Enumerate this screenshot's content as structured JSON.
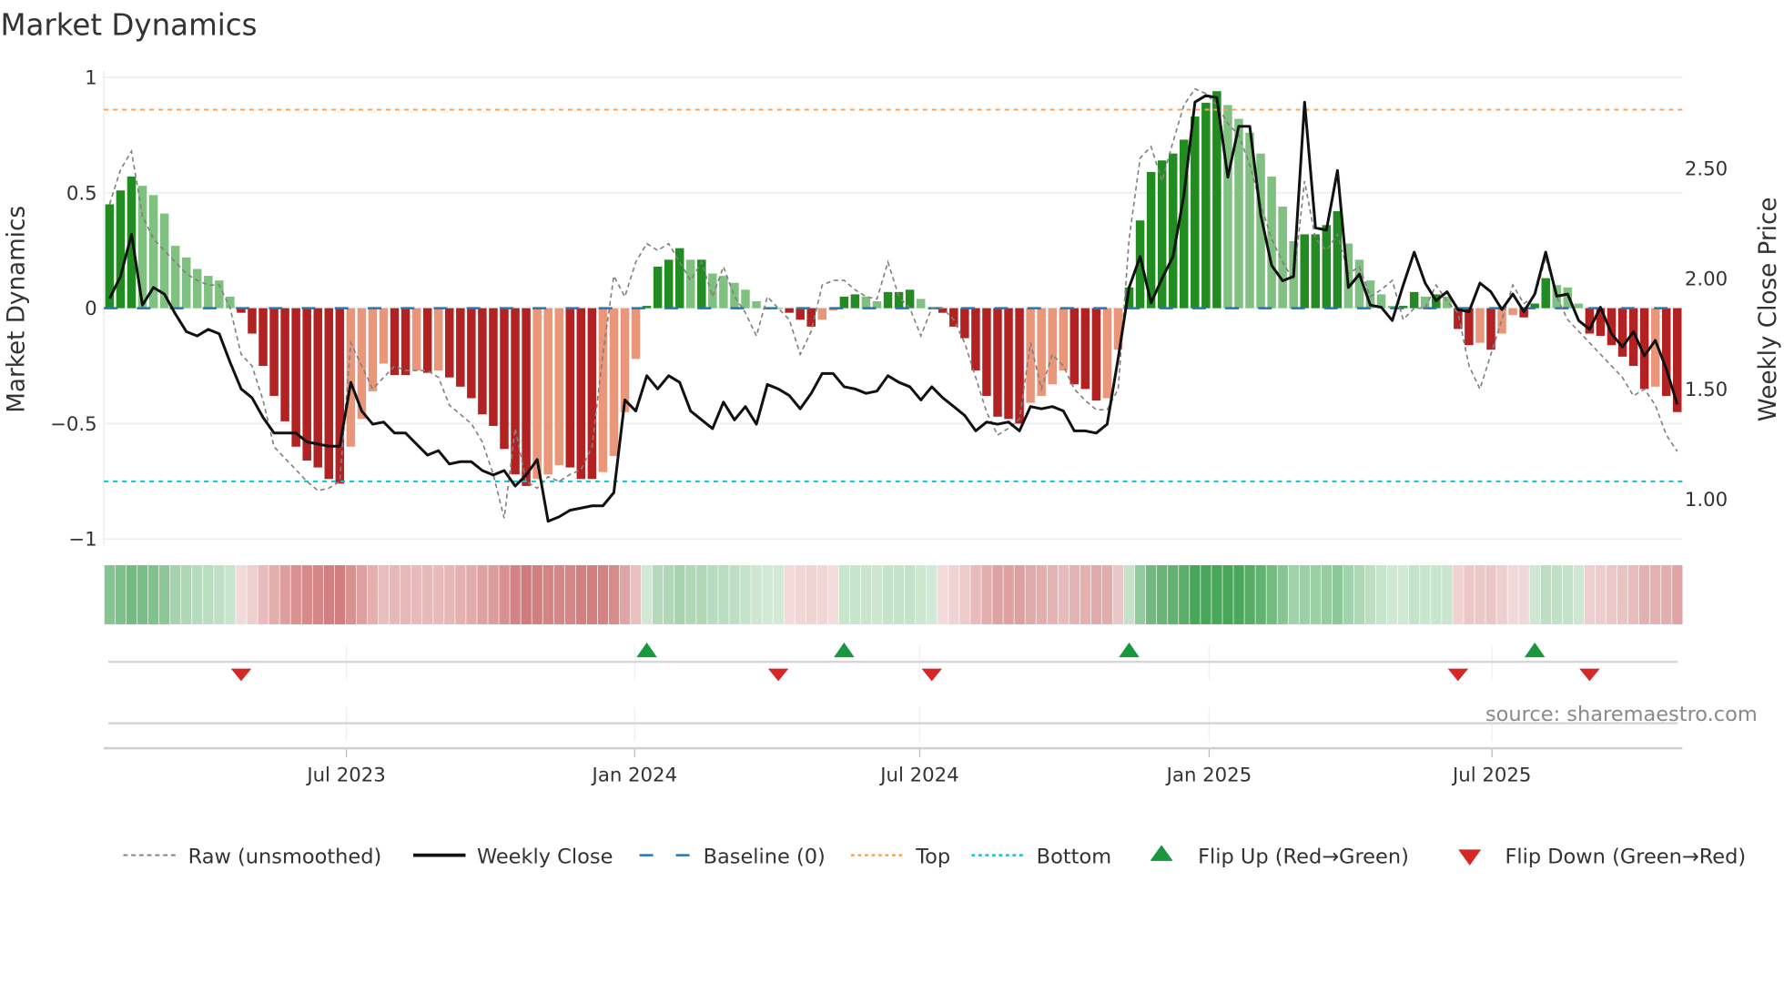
{
  "chart_data": {
    "type": "bar",
    "title": "Market Dynamics",
    "ylabel": "Market Dynamics",
    "y2label": "Weekly Close Price",
    "ylim": [
      -1,
      1
    ],
    "y2lim": [
      0.85,
      2.86
    ],
    "yticks": [
      "1",
      "0.5",
      "0",
      "−0.5",
      "−1"
    ],
    "ytick_values": [
      1,
      0.5,
      0,
      -0.5,
      -1
    ],
    "y2ticks": [
      "2.50",
      "2.00",
      "1.50",
      "1.00"
    ],
    "y2tick_values": [
      2.5,
      2.0,
      1.5,
      1.0
    ],
    "x_unit": "week index",
    "x_ticks": [
      {
        "label": "Jul 2023",
        "week": 21.6
      },
      {
        "label": "Jan 2024",
        "week": 47.9
      },
      {
        "label": "Jul 2024",
        "week": 73.9
      },
      {
        "label": "Jan 2025",
        "week": 100.3
      },
      {
        "label": "Jul 2025",
        "week": 126.1
      }
    ],
    "top_level": 0.86,
    "bottom_level": -0.75,
    "baseline": 0,
    "dynamics": [
      0.45,
      0.51,
      0.57,
      0.53,
      0.49,
      0.41,
      0.27,
      0.22,
      0.17,
      0.14,
      0.12,
      0.05,
      -0.02,
      -0.11,
      -0.25,
      -0.38,
      -0.49,
      -0.6,
      -0.66,
      -0.69,
      -0.74,
      -0.76,
      -0.6,
      -0.48,
      -0.36,
      -0.24,
      -0.29,
      -0.29,
      -0.27,
      -0.28,
      -0.27,
      -0.3,
      -0.34,
      -0.39,
      -0.46,
      -0.51,
      -0.61,
      -0.72,
      -0.77,
      -0.74,
      -0.72,
      -0.68,
      -0.69,
      -0.74,
      -0.74,
      -0.71,
      -0.64,
      -0.45,
      -0.22,
      0.01,
      0.18,
      0.21,
      0.26,
      0.21,
      0.21,
      0.15,
      0.14,
      0.11,
      0.08,
      0.03,
      0.0,
      0.0,
      -0.02,
      -0.05,
      -0.08,
      -0.05,
      -0.01,
      0.05,
      0.06,
      0.05,
      0.03,
      0.07,
      0.07,
      0.08,
      0.04,
      0.0,
      -0.02,
      -0.08,
      -0.13,
      -0.27,
      -0.38,
      -0.47,
      -0.48,
      -0.5,
      -0.41,
      -0.38,
      -0.33,
      -0.27,
      -0.33,
      -0.35,
      -0.4,
      -0.39,
      -0.18,
      0.09,
      0.38,
      0.59,
      0.64,
      0.67,
      0.73,
      0.83,
      0.89,
      0.94,
      0.88,
      0.82,
      0.76,
      0.67,
      0.57,
      0.44,
      0.29,
      0.32,
      0.32,
      0.36,
      0.42,
      0.28,
      0.21,
      0.12,
      0.06,
      0.01,
      0.01,
      0.07,
      0.05,
      0.06,
      0.05,
      -0.09,
      -0.16,
      -0.15,
      -0.18,
      -0.11,
      -0.03,
      -0.04,
      0.02,
      0.13,
      0.1,
      0.09,
      0.02,
      -0.11,
      -0.12,
      -0.16,
      -0.21,
      -0.25,
      -0.35,
      -0.34,
      -0.38,
      -0.45
    ],
    "raw": [
      0.45,
      0.6,
      0.68,
      0.4,
      0.3,
      0.25,
      0.2,
      0.15,
      0.12,
      0.1,
      0.1,
      0.0,
      -0.2,
      -0.25,
      -0.4,
      -0.6,
      -0.65,
      -0.7,
      -0.75,
      -0.79,
      -0.78,
      -0.75,
      -0.15,
      -0.25,
      -0.35,
      -0.3,
      -0.25,
      -0.27,
      -0.27,
      -0.27,
      -0.3,
      -0.42,
      -0.46,
      -0.5,
      -0.58,
      -0.72,
      -0.91,
      -0.52,
      -0.75,
      -0.78,
      -0.73,
      -0.75,
      -0.72,
      -0.7,
      -0.6,
      -0.2,
      0.14,
      0.05,
      0.2,
      0.28,
      0.25,
      0.28,
      0.2,
      0.12,
      0.2,
      0.05,
      0.18,
      0.05,
      -0.02,
      -0.12,
      0.05,
      0.0,
      -0.05,
      -0.2,
      -0.1,
      0.1,
      0.12,
      0.12,
      0.08,
      0.05,
      0.04,
      0.2,
      0.05,
      0.0,
      -0.12,
      0.0,
      0.0,
      -0.05,
      -0.15,
      -0.3,
      -0.45,
      -0.55,
      -0.52,
      -0.48,
      -0.15,
      -0.35,
      -0.2,
      -0.25,
      -0.35,
      -0.4,
      -0.44,
      -0.44,
      -0.35,
      0.3,
      0.65,
      0.7,
      0.55,
      0.72,
      0.88,
      0.95,
      0.93,
      0.88,
      0.8,
      0.75,
      0.62,
      0.45,
      0.3,
      0.2,
      0.12,
      0.55,
      0.3,
      0.25,
      0.32,
      0.15,
      0.18,
      0.05,
      0.08,
      0.12,
      -0.05,
      0.0,
      0.0,
      0.1,
      0.03,
      -0.02,
      -0.25,
      -0.35,
      -0.2,
      -0.05,
      0.1,
      0.02,
      0.05,
      0.22,
      0.05,
      -0.05,
      -0.1,
      -0.15,
      -0.2,
      -0.25,
      -0.3,
      -0.38,
      -0.35,
      -0.42,
      -0.55,
      -0.62
    ],
    "weekly_close": [
      1.91,
      2.01,
      2.2,
      1.88,
      1.96,
      1.93,
      1.84,
      1.76,
      1.74,
      1.77,
      1.75,
      1.62,
      1.5,
      1.46,
      1.37,
      1.3,
      1.3,
      1.3,
      1.26,
      1.25,
      1.24,
      1.24,
      1.53,
      1.4,
      1.34,
      1.35,
      1.3,
      1.3,
      1.25,
      1.2,
      1.22,
      1.16,
      1.17,
      1.17,
      1.13,
      1.11,
      1.13,
      1.06,
      1.11,
      1.18,
      0.9,
      0.92,
      0.95,
      0.96,
      0.97,
      0.97,
      1.03,
      1.45,
      1.4,
      1.56,
      1.5,
      1.56,
      1.53,
      1.4,
      1.36,
      1.32,
      1.44,
      1.36,
      1.42,
      1.34,
      1.52,
      1.5,
      1.47,
      1.41,
      1.48,
      1.57,
      1.57,
      1.51,
      1.5,
      1.48,
      1.49,
      1.56,
      1.53,
      1.51,
      1.45,
      1.51,
      1.46,
      1.42,
      1.38,
      1.31,
      1.35,
      1.34,
      1.35,
      1.31,
      1.42,
      1.41,
      1.42,
      1.4,
      1.31,
      1.31,
      1.3,
      1.34,
      1.64,
      1.96,
      2.1,
      1.89,
      2.0,
      2.1,
      2.38,
      2.8,
      2.83,
      2.82,
      2.46,
      2.69,
      2.69,
      2.29,
      2.06,
      1.99,
      2.01,
      2.8,
      2.23,
      2.22,
      2.49,
      1.96,
      2.02,
      1.88,
      1.87,
      1.81,
      1.97,
      2.12,
      1.98,
      1.9,
      1.94,
      1.86,
      1.85,
      1.98,
      1.94,
      1.86,
      1.93,
      1.85,
      1.93,
      2.12,
      1.92,
      1.93,
      1.81,
      1.77,
      1.87,
      1.75,
      1.69,
      1.76,
      1.65,
      1.72,
      1.59,
      1.43
    ],
    "flip_up_weeks": [
      49,
      67,
      93,
      130
    ],
    "flip_down_weeks": [
      12,
      61,
      75,
      123,
      135
    ],
    "legend_position": "bottom",
    "legend": {
      "raw": "Raw (unsmoothed)",
      "close": "Weekly Close",
      "baseline": "Baseline (0)",
      "top": "Top",
      "bottom": "Bottom",
      "flip_up": "Flip Up (Red→Green)",
      "flip_down": "Flip Down (Green→Red)"
    },
    "source": "source: sharemaestro.com",
    "colors": {
      "green_strong": "#228b22",
      "green_weak": "#80c080",
      "red_strong": "#b22222",
      "red_weak": "#e9967a",
      "top": "#f4a460",
      "bottom": "#17becf",
      "baseline": "#1f77b4",
      "raw": "#808080",
      "close": "#111111",
      "flip_up": "#1a9641",
      "flip_down": "#d62728"
    }
  }
}
